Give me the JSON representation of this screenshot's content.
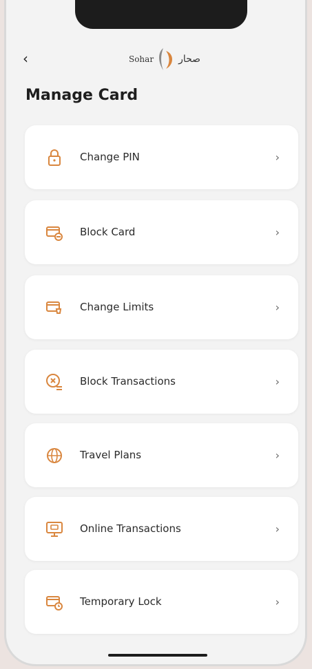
{
  "header": {
    "back_label": "‹",
    "logo_en": "Sohar",
    "logo_ar": "صحار"
  },
  "page_title": "Manage Card",
  "menu": [
    {
      "label": "Change PIN",
      "icon": "lock-icon"
    },
    {
      "label": "Block Card",
      "icon": "block-card-icon"
    },
    {
      "label": "Change Limits",
      "icon": "card-limits-icon"
    },
    {
      "label": "Block Transactions",
      "icon": "block-transactions-icon"
    },
    {
      "label": "Travel Plans",
      "icon": "globe-icon"
    },
    {
      "label": "Online Transactions",
      "icon": "online-transactions-icon"
    },
    {
      "label": "Temporary Lock",
      "icon": "card-clock-icon"
    }
  ],
  "chevron": "›",
  "colors": {
    "accent": "#d9863e",
    "background": "#f3f3f3",
    "card": "#ffffff"
  }
}
